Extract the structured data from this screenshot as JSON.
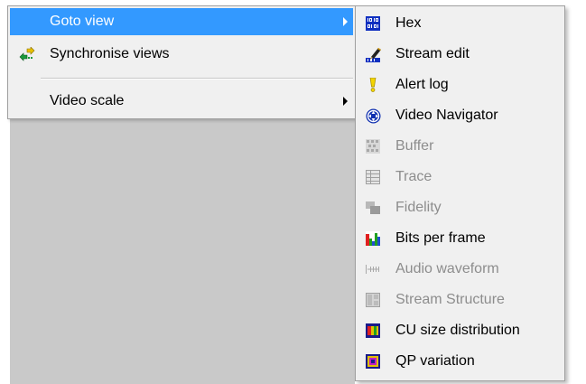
{
  "context_menu": {
    "items": [
      {
        "label": "Goto view",
        "icon": "none",
        "highlighted": true,
        "has_submenu": true
      },
      {
        "label": "Synchronise views",
        "icon": "sync-arrows-icon",
        "has_submenu": false
      },
      {
        "label": "Video scale",
        "icon": "none",
        "has_submenu": true
      }
    ]
  },
  "goto_view_submenu": {
    "items": [
      {
        "label": "Hex",
        "icon": "hex-icon",
        "enabled": true
      },
      {
        "label": "Stream edit",
        "icon": "stream-edit-icon",
        "enabled": true
      },
      {
        "label": "Alert log",
        "icon": "alert-log-icon",
        "enabled": true
      },
      {
        "label": "Video Navigator",
        "icon": "video-navigator-icon",
        "enabled": true
      },
      {
        "label": "Buffer",
        "icon": "buffer-icon",
        "enabled": false
      },
      {
        "label": "Trace",
        "icon": "trace-icon",
        "enabled": false
      },
      {
        "label": "Fidelity",
        "icon": "fidelity-icon",
        "enabled": false
      },
      {
        "label": "Bits per frame",
        "icon": "bits-per-frame-icon",
        "enabled": true
      },
      {
        "label": "Audio waveform",
        "icon": "audio-waveform-icon",
        "enabled": false
      },
      {
        "label": "Stream Structure",
        "icon": "stream-structure-icon",
        "enabled": false
      },
      {
        "label": "CU size distribution",
        "icon": "cu-size-distribution-icon",
        "enabled": true
      },
      {
        "label": "QP variation",
        "icon": "qp-variation-icon",
        "enabled": true
      }
    ]
  },
  "colors": {
    "highlight": "#3399ff",
    "menu_bg": "#f0f0f0",
    "disabled_text": "#8d8d8d",
    "app_background": "#c9c9c9"
  }
}
